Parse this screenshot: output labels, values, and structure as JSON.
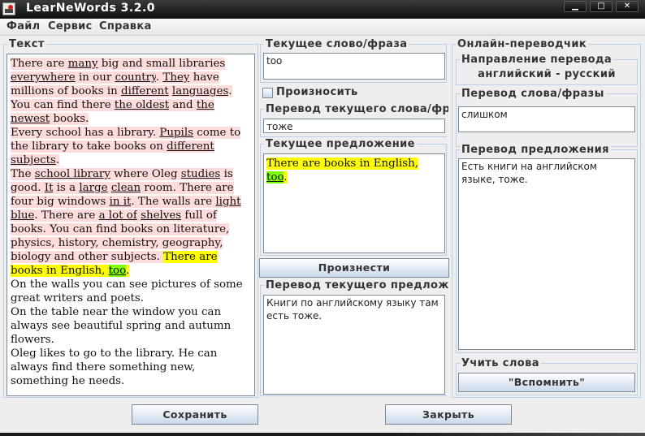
{
  "window": {
    "title": "LearNeWords 3.2.0",
    "controls": {
      "minimize": "▁",
      "maximize": "□",
      "close": "✕"
    }
  },
  "menu": [
    "Файл",
    "Сервис",
    "Справка"
  ],
  "text_panel": {
    "title": "Текст",
    "paragraphs": [
      {
        "highlight": "pink",
        "segments": [
          {
            "t": "There are "
          },
          {
            "t": "many",
            "u": true
          },
          {
            "t": " big and small libraries "
          },
          {
            "t": "everywhere",
            "u": true
          },
          {
            "t": " in our "
          },
          {
            "t": "country",
            "u": true
          },
          {
            "t": ". "
          },
          {
            "t": "They",
            "u": true
          },
          {
            "t": " have millions of books in "
          },
          {
            "t": "different",
            "u": true
          },
          {
            "t": " "
          },
          {
            "t": "languages",
            "u": true
          },
          {
            "t": ". You can find there "
          },
          {
            "t": "the oldest",
            "u": true
          },
          {
            "t": " and "
          },
          {
            "t": "the newest",
            "u": true
          },
          {
            "t": " books."
          }
        ]
      },
      {
        "highlight": "pink",
        "segments": [
          {
            "t": "Every school has a library. "
          },
          {
            "t": "Pupils",
            "u": true
          },
          {
            "t": " come to the library to take books on "
          },
          {
            "t": "different subjects",
            "u": true
          },
          {
            "t": "."
          }
        ]
      },
      {
        "highlight": "pink",
        "segments": [
          {
            "t": "The "
          },
          {
            "t": "school library",
            "u": true
          },
          {
            "t": " where Oleg "
          },
          {
            "t": "studies",
            "u": true
          },
          {
            "t": " is good. "
          },
          {
            "t": "It",
            "u": true
          },
          {
            "t": " is a "
          },
          {
            "t": "large",
            "u": true
          },
          {
            "t": " "
          },
          {
            "t": "clean",
            "u": true
          },
          {
            "t": " room. There are four big windows "
          },
          {
            "t": "in it",
            "u": true
          },
          {
            "t": ". The walls are "
          },
          {
            "t": "light blue",
            "u": true
          },
          {
            "t": ". There are "
          },
          {
            "t": "a lot of",
            "u": true
          },
          {
            "t": " "
          },
          {
            "t": "shelves",
            "u": true
          },
          {
            "t": " full of books. You can find books on literature, physics, history, chemistry, geography, biology and other subjects. "
          },
          {
            "t": "There are books in English, ",
            "hl": "yellow"
          },
          {
            "t": "too",
            "u": true,
            "hl": "green"
          },
          {
            "t": ".",
            "hl": "yellow"
          }
        ]
      },
      {
        "segments": [
          {
            "t": "On the walls you can see pictures of some great writers and poets."
          }
        ]
      },
      {
        "segments": [
          {
            "t": "On the table near the window you can always see beautiful spring and autumn flowers."
          }
        ]
      },
      {
        "segments": [
          {
            "t": "Oleg likes to go to the library. He can always find there something new, something he needs."
          }
        ]
      }
    ]
  },
  "current_word": {
    "title": "Текущее слово/фраза",
    "value": "too"
  },
  "pronounce_checkbox": {
    "label": "Произносить",
    "checked": false
  },
  "word_translation": {
    "title": "Перевод текущего слова/фразы",
    "value": "тоже"
  },
  "current_sentence": {
    "title": "Текущее предложение",
    "segments": [
      {
        "t": "There are books in English, ",
        "hl": "yellow"
      },
      {
        "t": "too",
        "u": true,
        "hl": "green"
      },
      {
        "t": ".",
        "hl": "yellow"
      }
    ]
  },
  "pronounce_button": "Произнести",
  "sentence_translation": {
    "title": "Перевод текущего предложения",
    "value": "Книги по английскому языку там есть тоже."
  },
  "online_translator": {
    "title": "Онлайн-переводчик",
    "direction_title": "Направление перевода",
    "direction_value": "английский - русский",
    "word_title": "Перевод слова/фразы",
    "word_value": "слишком",
    "sentence_title": "Перевод предложения",
    "sentence_value": "Есть книги на английском языке, тоже."
  },
  "learn_words": {
    "title": "Учить слова",
    "button": "\"Вспомнить\""
  },
  "footer": {
    "save": "Сохранить",
    "close": "Закрыть"
  },
  "colors": {
    "highlight_pink": "#ffdcdc",
    "highlight_yellow": "#ffff00",
    "highlight_green": "#7fff00",
    "group_border": "#b8cfe5"
  }
}
